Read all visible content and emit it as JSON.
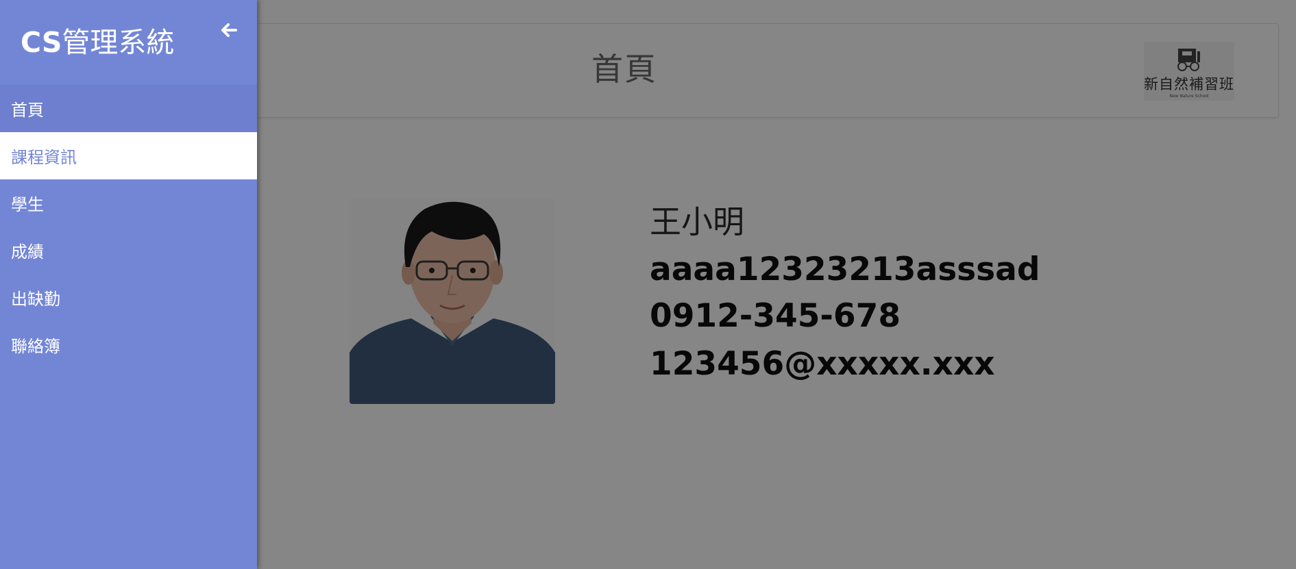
{
  "sidebar": {
    "brand_prefix": "CS",
    "brand_suffix": "管理系統",
    "back_icon": "arrow-left-icon",
    "items": [
      {
        "label": "首頁"
      },
      {
        "label": "課程資訊"
      },
      {
        "label": "學生"
      },
      {
        "label": "成績"
      },
      {
        "label": "出缺勤"
      },
      {
        "label": "聯絡簿"
      }
    ]
  },
  "header": {
    "title": "首頁",
    "logo_name": "新自然補習班",
    "logo_sub": "New Nature School"
  },
  "profile": {
    "name": "王小明",
    "id": "aaaa12323213asssad",
    "phone": "0912-345-678",
    "email": "123456@xxxxx.xxx"
  },
  "colors": {
    "sidebar": "#7386d6",
    "active_item_bg": "#ffffff",
    "overlay": "rgba(0,0,0,0.475)"
  }
}
